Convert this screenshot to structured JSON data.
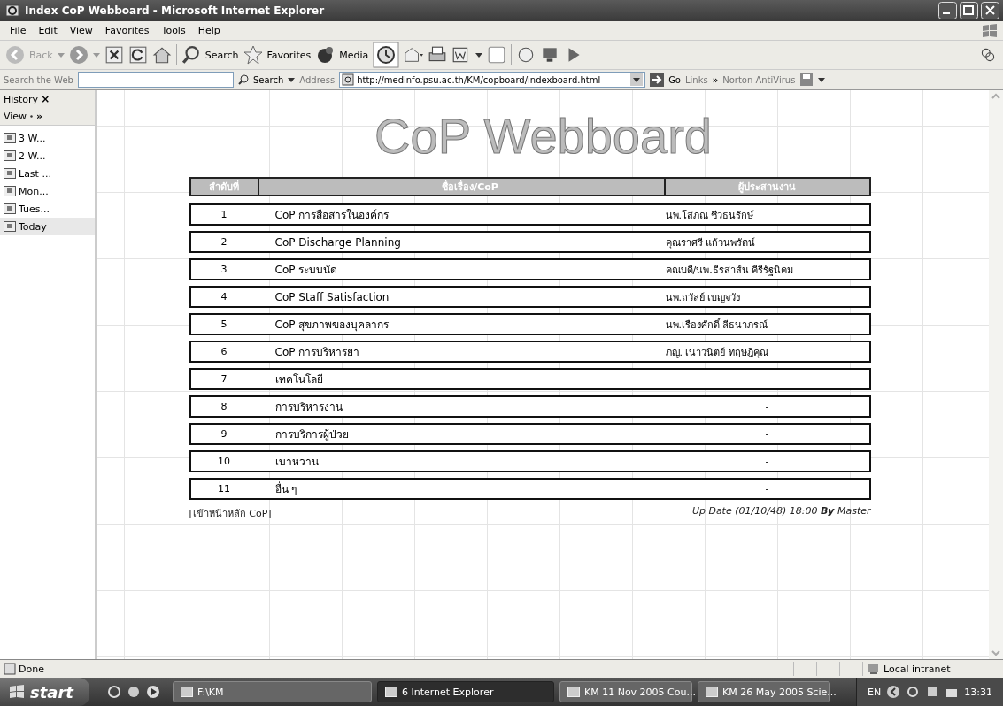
{
  "window": {
    "title": "Index CoP Webboard - Microsoft Internet Explorer"
  },
  "menu": [
    "File",
    "Edit",
    "View",
    "Favorites",
    "Tools",
    "Help"
  ],
  "toolbar": {
    "back": "Back",
    "search": "Search",
    "favorites": "Favorites",
    "media": "Media"
  },
  "search_bar": {
    "label": "Search the Web",
    "button": "Search"
  },
  "address_bar": {
    "label": "Address",
    "url": "http://medinfo.psu.ac.th/KM/copboard/indexboard.html",
    "go": "Go",
    "links": "Links",
    "links_more": "»",
    "norton": "Norton AntiVirus"
  },
  "sidebar": {
    "title": "History",
    "close": "×",
    "view": "View",
    "view_more": "»",
    "items": [
      {
        "label": "3 W...",
        "selected": false
      },
      {
        "label": "2 W...",
        "selected": false
      },
      {
        "label": "Last ...",
        "selected": false
      },
      {
        "label": "Mon...",
        "selected": false
      },
      {
        "label": "Tues...",
        "selected": false
      },
      {
        "label": "Today",
        "selected": true
      }
    ]
  },
  "page": {
    "heading": "CoP Webboard",
    "columns": [
      "ลำดับที่",
      "ชื่อเรื่อง/CoP",
      "ผู้ประสานงาน"
    ],
    "rows": [
      {
        "number": "1",
        "title": "CoP การสื่อสารในองค์กร",
        "coordinator": "นพ.โสภณ ชีวธนรักษ์"
      },
      {
        "number": "2",
        "title": "CoP Discharge Planning",
        "coordinator": "คุณราศรี แก้วนพรัตน์"
      },
      {
        "number": "3",
        "title": "CoP ระบบนัด",
        "coordinator": "คณบดี/นพ.ธีรสาส์น คีรีรัฐนิคม"
      },
      {
        "number": "4",
        "title": "CoP Staff Satisfaction",
        "coordinator": "นพ.ถวัลย์ เบญจวัง"
      },
      {
        "number": "5",
        "title": "CoP สุขภาพของบุคลากร",
        "coordinator": "นพ.เรืองศักดิ์ ลีธนาภรณ์"
      },
      {
        "number": "6",
        "title": "CoP การบริหารยา",
        "coordinator": "ภญ. เนาวนิตย์ ทฤษฎิคุณ"
      },
      {
        "number": "7",
        "title": "เทคโนโลยี",
        "coordinator": "-"
      },
      {
        "number": "8",
        "title": "การบริหารงาน",
        "coordinator": "-"
      },
      {
        "number": "9",
        "title": "การบริการผู้ป่วย",
        "coordinator": "-"
      },
      {
        "number": "10",
        "title": "เบาหวาน",
        "coordinator": "-"
      },
      {
        "number": "11",
        "title": "อื่น ๆ",
        "coordinator": "-"
      }
    ],
    "home_link": "[เข้าหน้าหลัก CoP]",
    "update": "Up Date (01/10/48) 18:00 **By** Master"
  },
  "status_bar": {
    "status": "Done",
    "zone": "Local intranet"
  },
  "taskbar": {
    "start": "start",
    "tasks": [
      {
        "label": "F:\\KM",
        "selected": false
      },
      {
        "label": "6 Internet Explorer",
        "selected": true
      },
      {
        "label": "KM 11 Nov 2005  Cou...",
        "selected": false
      },
      {
        "label": "KM 26 May 2005  Scie...",
        "selected": false
      }
    ],
    "language": "EN",
    "clock": "13:31"
  }
}
